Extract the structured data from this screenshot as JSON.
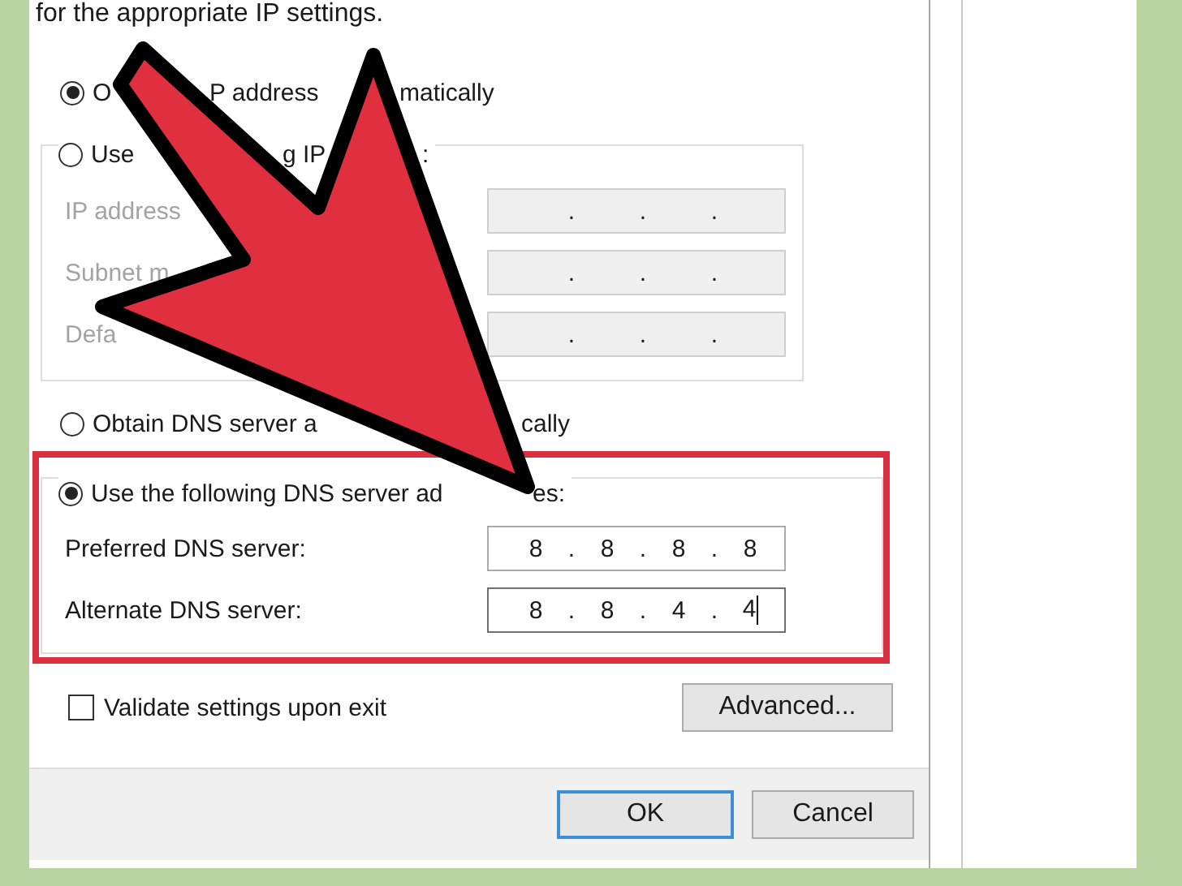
{
  "header": {
    "text": "for the appropriate IP settings."
  },
  "ip_mode": [
    {
      "label_parts": [
        "O",
        "P address",
        "matically"
      ],
      "selected": true
    },
    {
      "label_parts": [
        "Use",
        "g IP",
        ":"
      ],
      "selected": false
    }
  ],
  "ip_fields": [
    {
      "label": "IP address",
      "disabled": true,
      "separators": [
        ".",
        ".",
        "."
      ]
    },
    {
      "label": "Subnet m",
      "disabled": true,
      "separators": [
        ".",
        ".",
        "."
      ]
    },
    {
      "label": "Defa",
      "disabled": true,
      "separators": [
        ".",
        ".",
        "."
      ]
    }
  ],
  "dns_mode": [
    {
      "label_parts": [
        "Obtain DNS server a",
        "cally"
      ],
      "selected": false
    },
    {
      "label_parts": [
        "Use the following DNS server ad",
        "es:"
      ],
      "selected": true
    }
  ],
  "dns_fields": [
    {
      "label": "Preferred DNS server:",
      "disabled": false,
      "focused": false,
      "octets": [
        "8",
        "8",
        "8",
        "8"
      ],
      "separators": [
        ".",
        ".",
        "."
      ]
    },
    {
      "label": "Alternate DNS server:",
      "disabled": false,
      "focused": true,
      "octets": [
        "8",
        "8",
        "4",
        "4"
      ],
      "separators": [
        ".",
        ".",
        "."
      ]
    }
  ],
  "validate": {
    "label": "Validate settings upon exit",
    "checked": false
  },
  "advanced_button": {
    "label": "Advanced..."
  },
  "buttons": [
    {
      "label": "OK",
      "default": true
    },
    {
      "label": "Cancel",
      "default": false
    }
  ]
}
